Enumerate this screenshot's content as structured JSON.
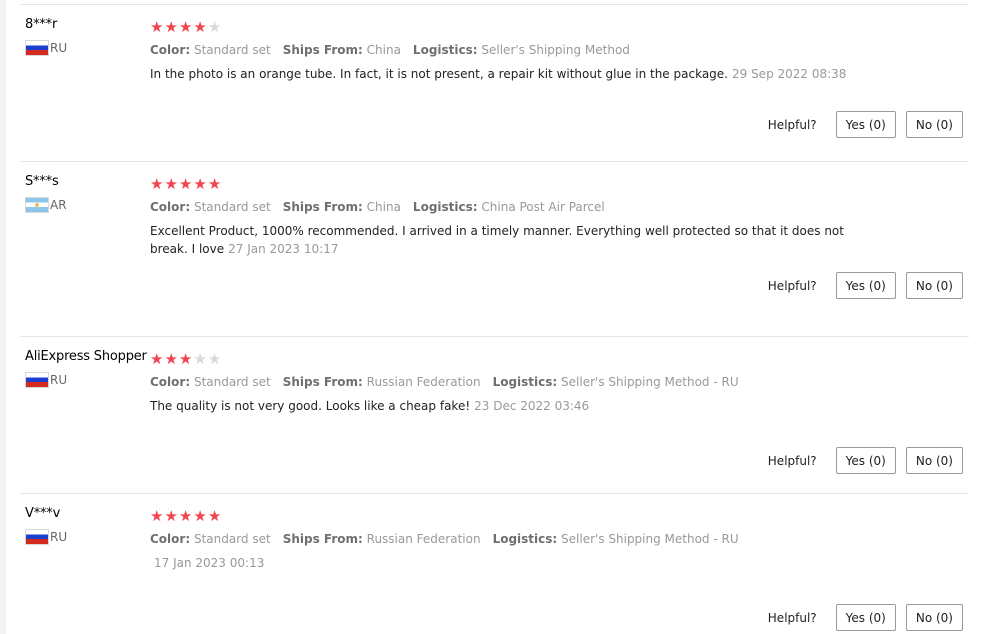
{
  "helpful_label": "Helpful?",
  "meta_keys": {
    "color": "Color:",
    "ships_from": "Ships From:",
    "logistics": "Logistics:"
  },
  "star_colors": {
    "on": "#f1454f",
    "off": "#d9d9d9"
  },
  "reviews": [
    {
      "user": "8***r",
      "country_code": "RU",
      "flag": "flag-ru",
      "rating": 4,
      "color": "Standard set",
      "ships_from": "China",
      "logistics": "Seller's Shipping Method",
      "text": "In the photo is an orange tube. In fact, it is not present, a repair kit without glue in the package.",
      "date": "29 Sep 2022 08:38",
      "yes": "Yes (0)",
      "no": "No (0)"
    },
    {
      "user": "S***s",
      "country_code": "AR",
      "flag": "flag-ar",
      "rating": 5,
      "color": "Standard set",
      "ships_from": "China",
      "logistics": "China Post Air Parcel",
      "text": "Excellent Product, 1000% recommended. I arrived in a timely manner. Everything well protected so that it does not break. I love",
      "date": "27 Jan 2023 10:17",
      "yes": "Yes (0)",
      "no": "No (0)"
    },
    {
      "user": "AliExpress Shopper",
      "country_code": "RU",
      "flag": "flag-ru",
      "rating": 3,
      "color": "Standard set",
      "ships_from": "Russian Federation",
      "logistics": "Seller's Shipping Method - RU",
      "text": "The quality is not very good. Looks like a cheap fake!",
      "date": "23 Dec 2022 03:46",
      "yes": "Yes (0)",
      "no": "No (0)"
    },
    {
      "user": "V***v",
      "country_code": "RU",
      "flag": "flag-ru",
      "rating": 5,
      "color": "Standard set",
      "ships_from": "Russian Federation",
      "logistics": "Seller's Shipping Method - RU",
      "text": "",
      "date": "17 Jan 2023 00:13",
      "yes": "Yes (0)",
      "no": "No (0)"
    }
  ]
}
